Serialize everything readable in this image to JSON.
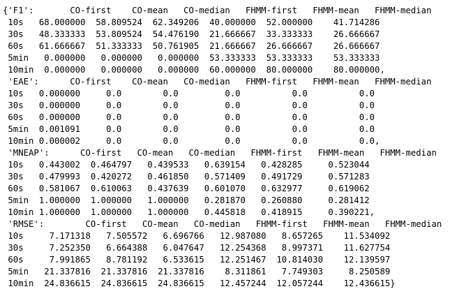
{
  "output": {
    "lines": [
      "{'F1':       CO-first    CO-mean   CO-median   FHMM-first   FHMM-mean   FHMM-median",
      " 10s   68.000000  58.809524  62.349206  40.000000  52.000000    41.714286",
      " 30s   48.333333  53.809524  54.476190  21.666667  33.333333    26.666667",
      " 60s   61.666667  51.333333  50.761905  21.666667  26.666667    26.666667",
      " 5min   0.000000   0.000000   0.000000  53.333333  53.333333    53.333333",
      " 10min  0.000000   0.000000   0.000000  60.000000  80.000000    80.000000,",
      " 'EAE':      CO-first    CO-mean   CO-median   FHMM-first   FHMM-mean   FHMM-median",
      " 10s   0.000000     0.0        0.0         0.0          0.0          0.0",
      " 30s   0.000000     0.0        0.0         0.0          0.0          0.0",
      " 60s   0.000000     0.0        0.0         0.0          0.0          0.0",
      " 5min  0.001091     0.0        0.0         0.0          0.0          0.0",
      " 10min 0.000002     0.0        0.0         0.0          0.0          0.0,",
      " 'MNEAP':      CO-first   CO-mean   CO-median   FHMM-first   FHMM-mean   FHMM-median",
      " 10s   0.443002  0.464797   0.439533   0.639154   0.428285     0.523044",
      " 30s   0.479993  0.420272   0.461850   0.571409   0.491729     0.571283",
      " 60s   0.581067  0.610063   0.437639   0.601070   0.632977     0.619062",
      " 5min  1.000000  1.000000   1.000000   0.281870   0.260880     0.281412",
      " 10min 1.000000  1.000000   1.000000   0.445818   0.418915     0.390221,",
      " 'RMSE':        CO-first   CO-mean   CO-median   FHMM-first   FHMM-mean   FHMM-median",
      " 10s     7.171318   7.505572   6.696766   12.987080   8.657265    11.534092",
      " 30s     7.252350   6.664388   6.047647   12.254368   8.997371    11.627754",
      " 60s     7.991865   8.781192   6.533615   12.251467  10.814030    12.139597",
      " 5min   21.337816  21.337816  21.337816    8.311861   7.749303     8.250589",
      " 10min  24.836615  24.836615  24.836615   12.457244  12.057244    12.436615}"
    ]
  }
}
